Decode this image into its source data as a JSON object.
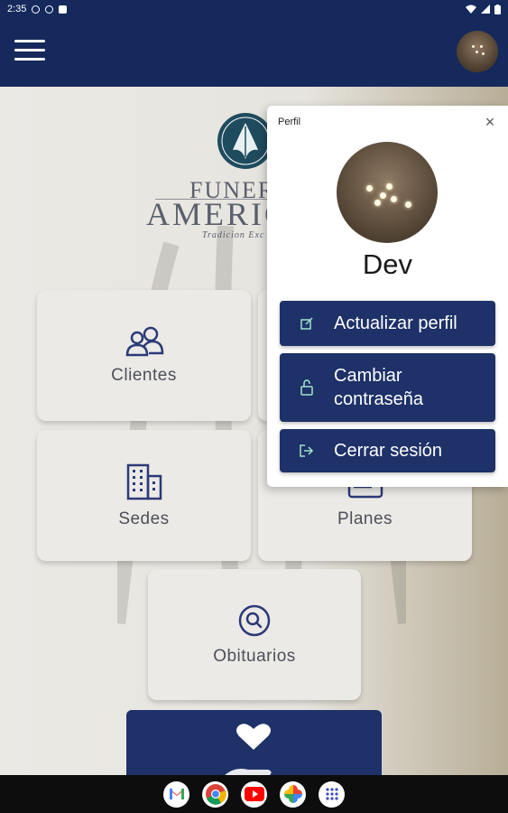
{
  "status_bar": {
    "time": "2:35"
  },
  "app_bar": {
    "menu_icon": "hamburger-menu-icon",
    "avatar": "profile-avatar"
  },
  "brand": {
    "line1": "FUNERA",
    "line2": "AMERIC",
    "line3": "Tradicion Exc"
  },
  "cards": [
    {
      "label": "Clientes",
      "icon": "users-icon"
    },
    {
      "label": "Sedes",
      "icon": "building-icon"
    },
    {
      "label": "Planes",
      "icon": "plans-icon"
    },
    {
      "label": "Obituarios",
      "icon": "search-icon"
    }
  ],
  "popup": {
    "title": "Perfil",
    "close_label": "×",
    "user_name": "Dev",
    "buttons": [
      {
        "label": "Actualizar perfil",
        "icon": "edit-icon"
      },
      {
        "label": "Cambiar contraseña",
        "icon": "lock-icon"
      },
      {
        "label": "Cerrar sesión",
        "icon": "logout-icon"
      }
    ]
  },
  "nav_apps": [
    "gmail-icon",
    "chrome-icon",
    "youtube-icon",
    "photos-icon",
    "app-drawer-icon"
  ],
  "colors": {
    "primary": "#1e3168",
    "appbar": "#15295c",
    "icon": "#2b3a78"
  }
}
